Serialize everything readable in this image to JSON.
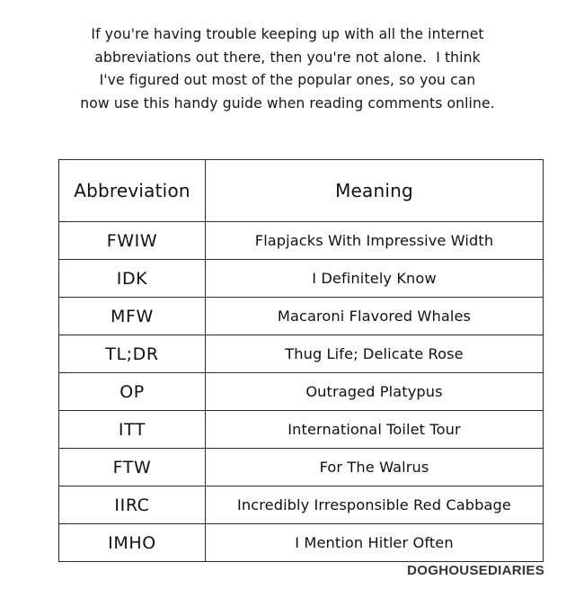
{
  "intro": {
    "lines": [
      "If you're having trouble keeping up with all the internet",
      "abbreviations out there, then you're not alone.  I think",
      "I've figured out most of the popular ones, so you can",
      "now use this handy guide when reading comments online."
    ]
  },
  "table": {
    "headers": {
      "abbreviation": "Abbreviation",
      "meaning": "Meaning"
    },
    "rows": [
      {
        "abbreviation": "FWIW",
        "meaning": "Flapjacks With Impressive Width"
      },
      {
        "abbreviation": "IDK",
        "meaning": "I Definitely Know"
      },
      {
        "abbreviation": "MFW",
        "meaning": "Macaroni Flavored Whales"
      },
      {
        "abbreviation": "TL;DR",
        "meaning": "Thug Life; Delicate Rose"
      },
      {
        "abbreviation": "OP",
        "meaning": "Outraged Platypus"
      },
      {
        "abbreviation": "ITT",
        "meaning": "International Toilet Tour"
      },
      {
        "abbreviation": "FTW",
        "meaning": "For The Walrus"
      },
      {
        "abbreviation": "IIRC",
        "meaning": "Incredibly Irresponsible Red Cabbage"
      },
      {
        "abbreviation": "IMHO",
        "meaning": "I Mention Hitler Often"
      }
    ]
  },
  "credit": {
    "text": "DOGHOUSEDIARIES"
  },
  "colors": {
    "background": "#ffffff",
    "text": "#111111",
    "border": "#2b2b2b",
    "credit": "#333333"
  }
}
